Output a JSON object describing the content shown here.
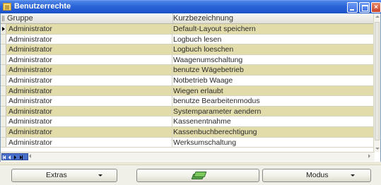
{
  "window": {
    "title": "Benutzerrechte"
  },
  "grid": {
    "columns": [
      "Gruppe",
      "Kurzbezeichnung"
    ],
    "rows": [
      {
        "gruppe": "Administrator",
        "kurz": "Default-Layout speichern",
        "selected": true
      },
      {
        "gruppe": "Administrator",
        "kurz": "Logbuch lesen"
      },
      {
        "gruppe": "Administrator",
        "kurz": "Logbuch loeschen"
      },
      {
        "gruppe": "Administrator",
        "kurz": "Waagenumschaltung"
      },
      {
        "gruppe": "Administrator",
        "kurz": "benutze Wägebetrieb"
      },
      {
        "gruppe": "Administrator",
        "kurz": "Notbetrieb Waage"
      },
      {
        "gruppe": "Administrator",
        "kurz": "Wiegen erlaubt"
      },
      {
        "gruppe": "Administrator",
        "kurz": "benutze Bearbeitenmodus"
      },
      {
        "gruppe": "Administrator",
        "kurz": "Systemparameter aendern"
      },
      {
        "gruppe": "Administrator",
        "kurz": "Kassenentnahme"
      },
      {
        "gruppe": "Administrator",
        "kurz": "Kassenbuchberechtigung"
      },
      {
        "gruppe": "Administrator",
        "kurz": "Werksumschaltung"
      }
    ]
  },
  "toolbar": {
    "extras_label": "Extras",
    "modus_label": "Modus"
  },
  "colors": {
    "row_alt": "#e2dcab",
    "title_bar": "#2a63d8"
  }
}
